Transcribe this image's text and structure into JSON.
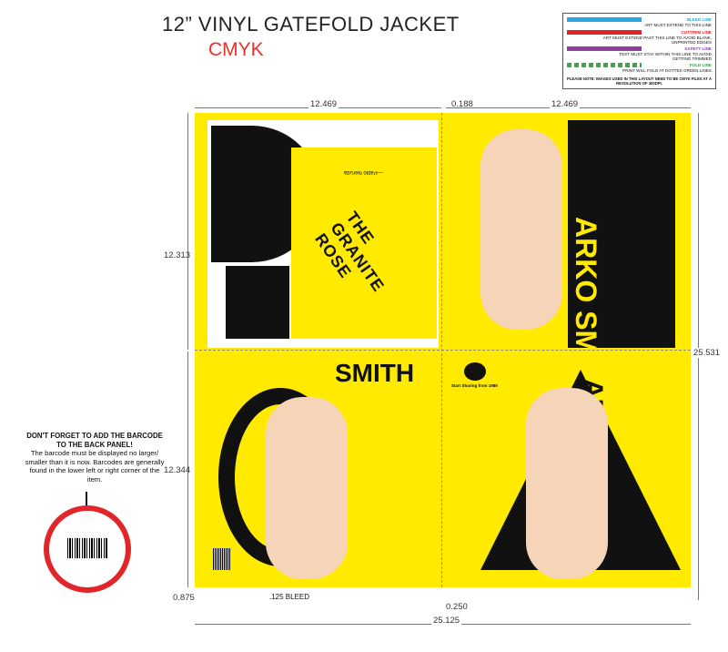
{
  "header": {
    "title": "12” VINYL GATEFOLD JACKET",
    "mode": "CMYK"
  },
  "legend": {
    "items": [
      {
        "name": "BLEED LINE",
        "desc": "ART MUST EXTEND TO THIS LINE",
        "color": "#2aa8e0"
      },
      {
        "name": "CUT/TRIM LINE",
        "desc": "ART MUST EXTEND PAST THIS LINE TO AVOID BLANK, UNPRINTED EDGES",
        "color": "#e1262a"
      },
      {
        "name": "SAFETY LINE",
        "desc": "TEXT MUST STAY WITHIN THIS LINE TO AVOID GETTING TRIMMED",
        "color": "#8e3fa0"
      },
      {
        "name": "FOLD LINE",
        "desc": "PRINT WILL FOLD AT DOTTED GREEN LINES",
        "color": "#3aa64a"
      }
    ],
    "note": "PLEASE NOTE: IMAGES USED IN THIS LAYOUT NEED TO BE CMYK FILES AT A RESOLUTION OF 300DPI."
  },
  "dimensions": {
    "top_left": "12.469",
    "top_gap": "0.188",
    "top_right": "12.469",
    "left_upper": "12.313",
    "left_lower": "12.344",
    "right_total": "25.531",
    "bottom_bleed_left": "0.875",
    "bottom_gap": "0.250",
    "bottom_total": "25.125",
    "bleed_label": ".125 BLEED"
  },
  "artwork": {
    "artist_top": "ARKO SMITH",
    "album_title": "THE GRANITE ROSE",
    "back_smith": "SMITH",
    "front_arko": "ARKO",
    "label_caption": "Start Sharing from 1989",
    "poem_credit": "—Pablo Neruda"
  },
  "barcode_note": {
    "heading": "DON'T FORGET TO ADD THE BARCODE TO THE BACK PANEL!",
    "body": "The barcode must be displayed no larger/ smaller than it is now. Barcodes are generally found in the lower left or right corner of the item."
  },
  "colors": {
    "jacket": "#ffea00",
    "black": "#111111",
    "cmyk_red": "#e8312a"
  }
}
